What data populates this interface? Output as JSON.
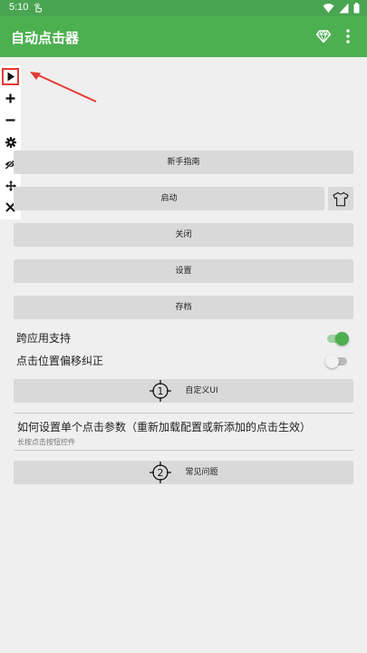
{
  "status_bar": {
    "time": "5:10",
    "icons": [
      "touch-icon",
      "wifi-icon",
      "signal-icon",
      "battery-icon"
    ]
  },
  "app_bar": {
    "title": "自动点击器",
    "icons": [
      "diamond-icon",
      "more-vert-icon"
    ],
    "color": "#4caf50"
  },
  "floating_toolbar": {
    "icons": [
      "play-icon",
      "plus-icon",
      "minus-icon",
      "gear-icon",
      "eye-off-icon",
      "move-icon",
      "close-icon"
    ],
    "highlight_color": "#e53935"
  },
  "buttons": {
    "beginner_guide": "新手指南",
    "start": "启动",
    "close": "关闭",
    "settings": "设置",
    "archive": "存档",
    "custom_ui": "自定义UI",
    "faq": "常见问题"
  },
  "toggles": {
    "cross_app": {
      "label": "跨应用支持",
      "on": true
    },
    "position_correction": {
      "label": "点击位置偏移纠正",
      "on": false
    }
  },
  "info": {
    "title": "如何设置单个点击参数（重新加载配置或新添加的点击生效）",
    "subtitle": "长按点击按钮控件"
  },
  "markers": {
    "custom_ui_number": "1",
    "faq_number": "2"
  }
}
